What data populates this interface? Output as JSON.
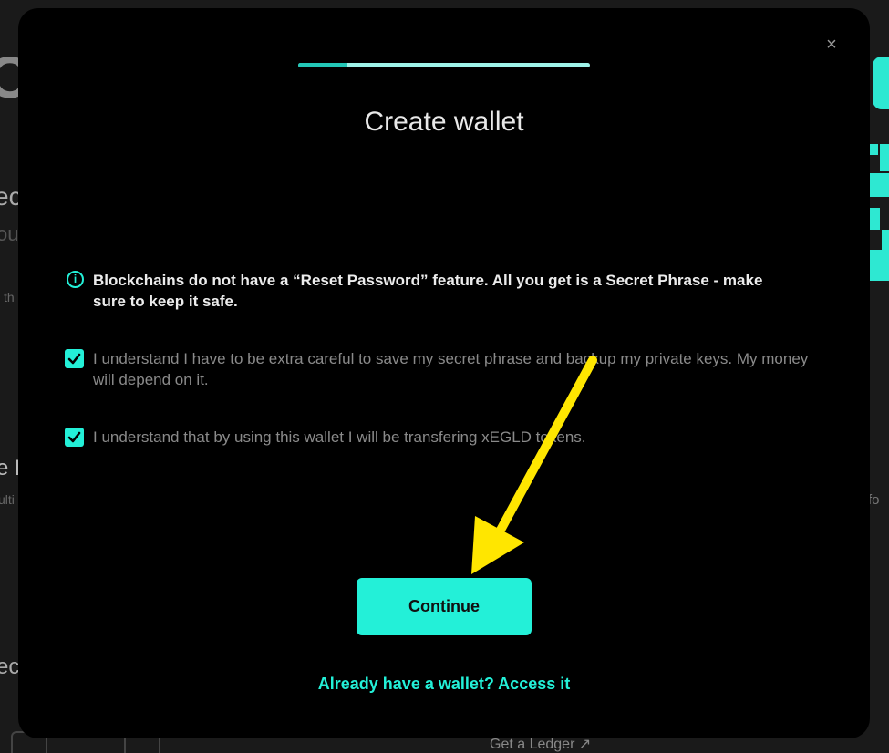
{
  "background": {
    "fragments": [
      "O",
      "ec",
      "ou",
      "th",
      "e E",
      "ulti",
      "ec",
      "fo",
      "Get a Ledger ↗"
    ]
  },
  "modal": {
    "close_icon": "×",
    "progress_fraction": 0.17,
    "title": "Create wallet",
    "notice": {
      "icon": "info-icon",
      "icon_glyph": "i",
      "text": "Blockchains do not have a “Reset Password” feature. All you get is a Secret Phrase - make sure to keep it safe."
    },
    "checkboxes": [
      {
        "checked": true,
        "label": "I understand I have to be extra careful to save my secret phrase and backup my private keys. My money will depend on it."
      },
      {
        "checked": true,
        "label": "I understand that by using this wallet I will be transfering xEGLD tokens."
      }
    ],
    "continue_label": "Continue",
    "access_link": "Already have a wallet? Access it"
  },
  "colors": {
    "accent": "#23f0d8",
    "modal_bg": "#000000",
    "annotation_arrow": "#ffe600"
  }
}
